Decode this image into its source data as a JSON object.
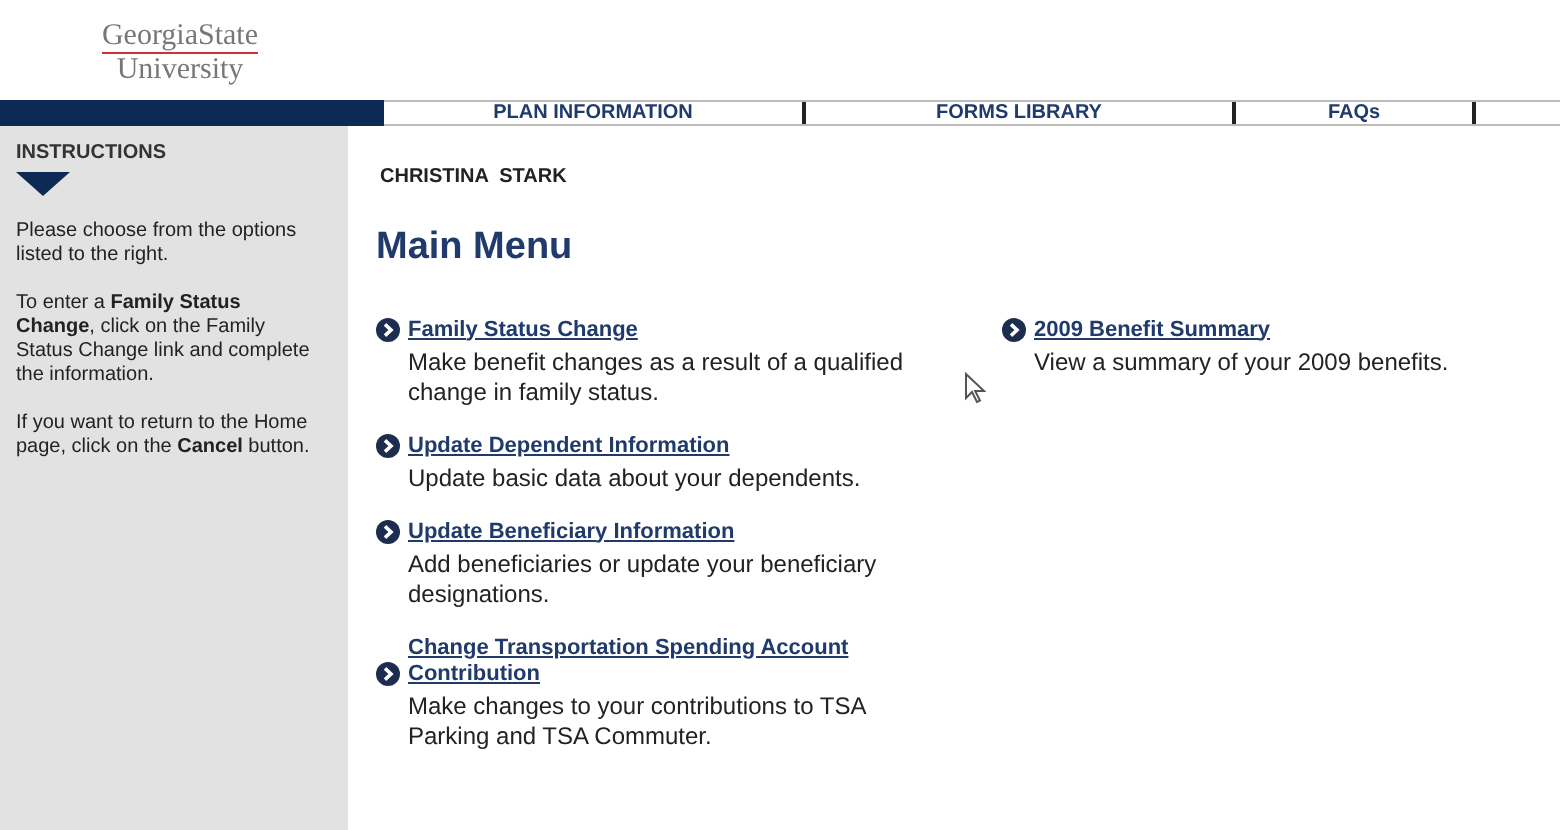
{
  "logo": {
    "line_1": "GeorgiaState",
    "line_2": "University"
  },
  "nav": [
    "PLAN INFORMATION",
    "FORMS LIBRARY",
    "FAQs"
  ],
  "sidebar": {
    "title": "INSTRUCTIONS",
    "paragraphs": [
      "Please choose from the options listed to the right.",
      "To enter a **Family Status Change**, click on the Family Status Change link and complete the information.",
      "If you want to return to the Home page, click on the **Cancel** button."
    ]
  },
  "user_name": "CHRISTINA  STARK",
  "heading": "Main Menu",
  "menu_columns": [
    [
      {
        "link": "Family Status Change",
        "description": "Make benefit changes as a result of a qualified change in family status."
      },
      {
        "link": "Update Dependent Information",
        "description": "Update basic data about your dependents."
      },
      {
        "link": "Update Beneficiary Information",
        "description": "Add beneficiaries or update your beneficiary designations."
      },
      {
        "link": "Change Transportation Spending Account Contribution",
        "description": "Make changes to your contributions to TSA Parking and TSA Commuter."
      }
    ],
    [
      {
        "link": "2009 Benefit Summary",
        "description": "View a summary of your 2009 benefits."
      }
    ]
  ]
}
